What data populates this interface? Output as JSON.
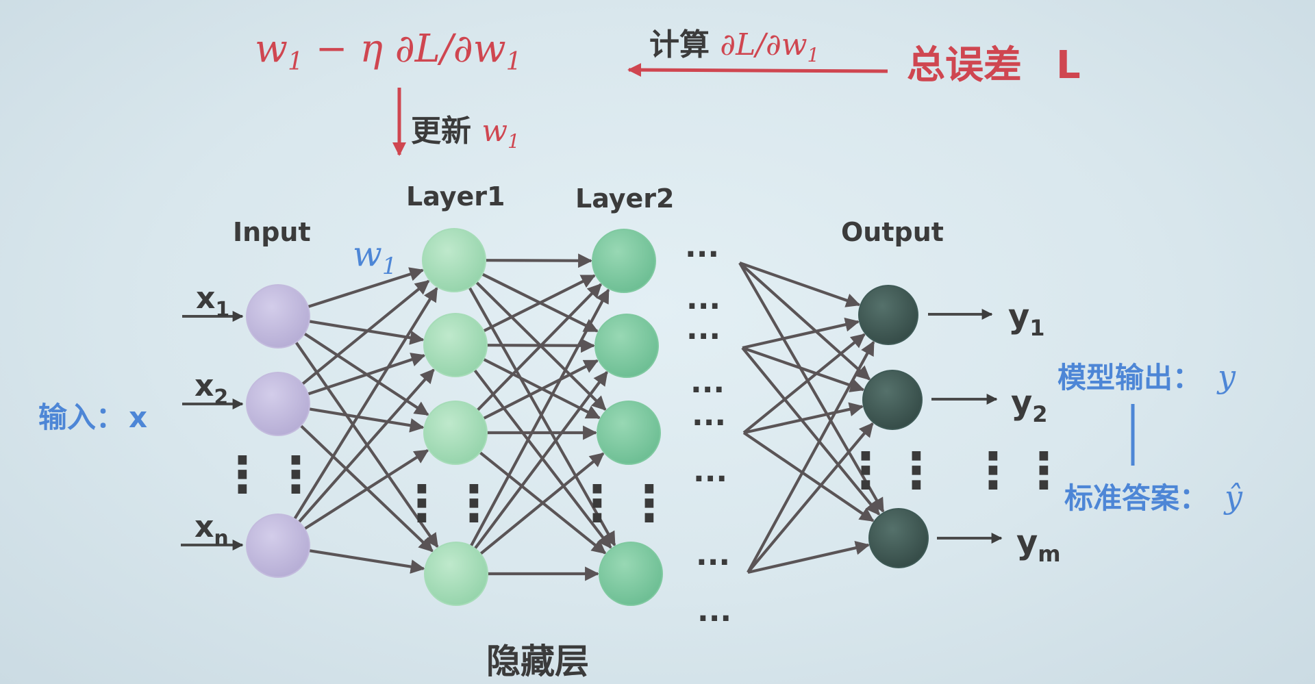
{
  "update_formula": {
    "w": "w",
    "w_sub": "1",
    "minus_eta": " − η ∂L/∂w",
    "w2_sub": "1"
  },
  "compute_label": {
    "text": "计算 ",
    "math": "∂L/∂w",
    "sub": "1"
  },
  "total_error": {
    "text": "总误差",
    "symbol": "L"
  },
  "update_label": {
    "text": "更新 ",
    "math": "w",
    "sub": "1"
  },
  "layers": {
    "input": "Input",
    "layer1": "Layer1",
    "layer2": "Layer2",
    "output": "Output",
    "hidden": "隐藏层"
  },
  "weight_label": {
    "w": "w",
    "sub": "1"
  },
  "inputs": [
    {
      "x": "x",
      "sub": "1"
    },
    {
      "x": "x",
      "sub": "2"
    },
    {
      "x": "x",
      "sub": "n"
    }
  ],
  "outputs": [
    {
      "y": "y",
      "sub": "1"
    },
    {
      "y": "y",
      "sub": "2"
    },
    {
      "y": "y",
      "sub": "m"
    }
  ],
  "input_caption": {
    "text": "输入：",
    "var": "x"
  },
  "model_output": {
    "text": "模型输出：",
    "var": "y"
  },
  "standard_answer": {
    "text": "标准答案：",
    "var": "ŷ"
  },
  "ellipsis_h": "···",
  "ellipsis_v": "⋮",
  "colors": {
    "input_node": "#c3bbdd",
    "layer1_node": "#a6dcb8",
    "layer2_node": "#7fc9a0",
    "output_node": "#3f5a56",
    "red": "#cf4650",
    "blue": "#4d86d6",
    "edge": "#5a5456"
  }
}
